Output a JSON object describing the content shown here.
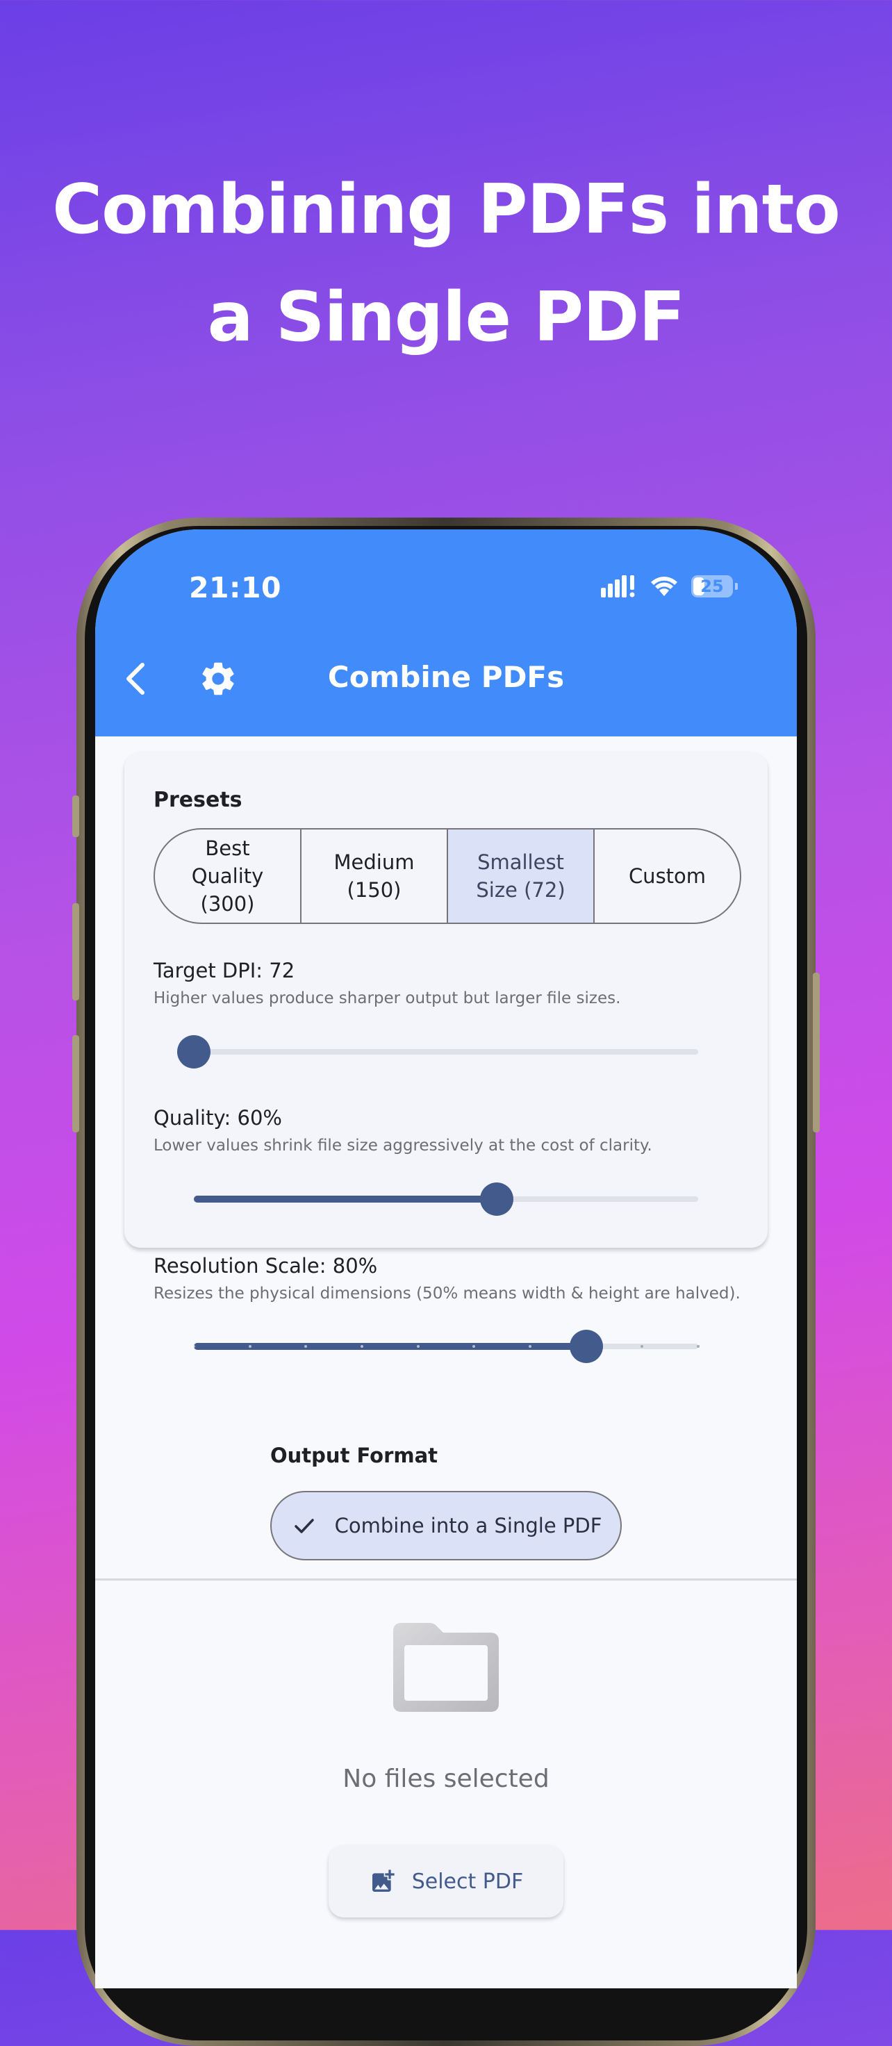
{
  "headline": {
    "line1": "Combining PDFs into",
    "line2": "a Single PDF"
  },
  "status_bar": {
    "time": "21:10",
    "battery": "25",
    "icons": [
      "cellular-signal-icon",
      "wifi-icon",
      "battery-icon"
    ]
  },
  "appbar": {
    "title": "Combine PDFs",
    "icons": [
      "back-chevron-icon",
      "gear-icon"
    ]
  },
  "presets": {
    "heading": "Presets",
    "options": [
      {
        "label": "Best\nQuality\n(300)",
        "selected": false
      },
      {
        "label": "Medium\n(150)",
        "selected": false
      },
      {
        "label": "Smallest\nSize (72)",
        "selected": true
      },
      {
        "label": "Custom",
        "selected": false
      }
    ]
  },
  "settings": {
    "dpi": {
      "label": "Target DPI: 72",
      "help": "Higher values produce sharper output but larger file sizes.",
      "value_fraction": 0
    },
    "quality": {
      "label": "Quality: 60%",
      "help": "Lower values shrink file size aggressively at the cost of clarity.",
      "value_fraction": 0.6
    },
    "resolution": {
      "label": "Resolution Scale: 80%",
      "help": "Resizes the physical dimensions (50% means width & height are halved).",
      "value_fraction": 0.778,
      "tick_count": 10
    }
  },
  "output": {
    "heading": "Output Format",
    "chip_label": "Combine into a Single PDF"
  },
  "empty_state": {
    "text": "No files selected",
    "icon": "folder-icon"
  },
  "select_button": {
    "label": "Select PDF",
    "icon": "add-photo-icon"
  },
  "colors": {
    "appbar": "#418cfa",
    "accent": "#435b8c",
    "selected_segment": "#dbe1f7"
  }
}
